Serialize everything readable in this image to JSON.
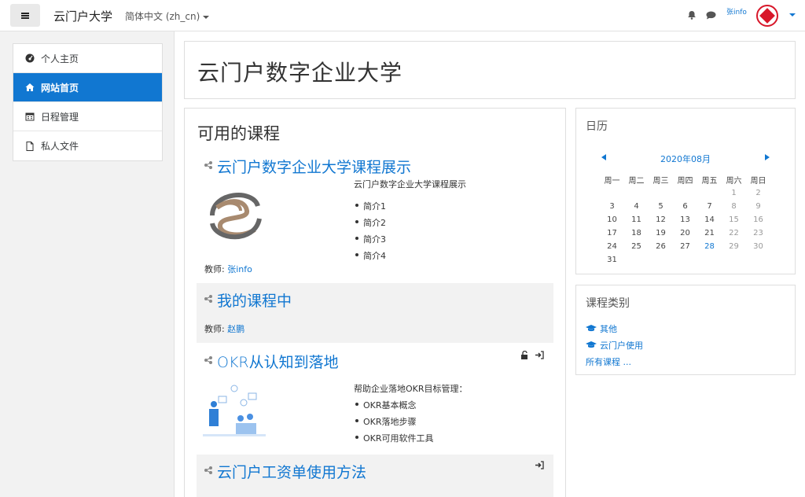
{
  "navbar": {
    "site_name": "云门户大学",
    "language": "简体中文 (zh_cn)",
    "user_name": "张info"
  },
  "drawer": {
    "items": [
      {
        "label": "个人主页",
        "icon": "dashboard-icon"
      },
      {
        "label": "网站首页",
        "icon": "home-icon",
        "active": true
      },
      {
        "label": "日程管理",
        "icon": "calendar-icon"
      },
      {
        "label": "私人文件",
        "icon": "file-icon"
      }
    ]
  },
  "hero": {
    "title": "云门户数字企业大学"
  },
  "courses": {
    "heading": "可用的课程",
    "teacher_label": "教师: ",
    "list": [
      {
        "title": "云门户数字企业大学课程展示",
        "intro": "云门户数字企业大学课程展示",
        "bullets": [
          "简介1",
          "简介2",
          "简介3",
          "简介4"
        ],
        "teacher": "张info"
      },
      {
        "title": "我的课程中",
        "teacher": "赵鹏"
      },
      {
        "title": "OKR从认知到落地",
        "intro": "帮助企业落地OKR目标管理：",
        "bullets": [
          "OKR基本概念",
          "OKR落地步骤",
          "OKR可用软件工具"
        ]
      },
      {
        "title": "云门户工资单使用方法"
      }
    ]
  },
  "calendar": {
    "title": "日历",
    "month": "2020年08月",
    "weekdays": [
      "周一",
      "周二",
      "周三",
      "周四",
      "周五",
      "周六",
      "周日"
    ],
    "weeks": [
      [
        "",
        "",
        "",
        "",
        "",
        "1",
        "2"
      ],
      [
        "3",
        "4",
        "5",
        "6",
        "7",
        "8",
        "9"
      ],
      [
        "10",
        "11",
        "12",
        "13",
        "14",
        "15",
        "16"
      ],
      [
        "17",
        "18",
        "19",
        "20",
        "21",
        "22",
        "23"
      ],
      [
        "24",
        "25",
        "26",
        "27",
        "28",
        "29",
        "30"
      ],
      [
        "31",
        "",
        "",
        "",
        "",
        "",
        ""
      ]
    ],
    "today": "28"
  },
  "categories": {
    "title": "课程类别",
    "items": [
      "其他",
      "云门户使用"
    ],
    "all_courses": "所有课程 ..."
  },
  "colors": {
    "accent": "#1177d1",
    "logo_red": "#d8172a"
  }
}
